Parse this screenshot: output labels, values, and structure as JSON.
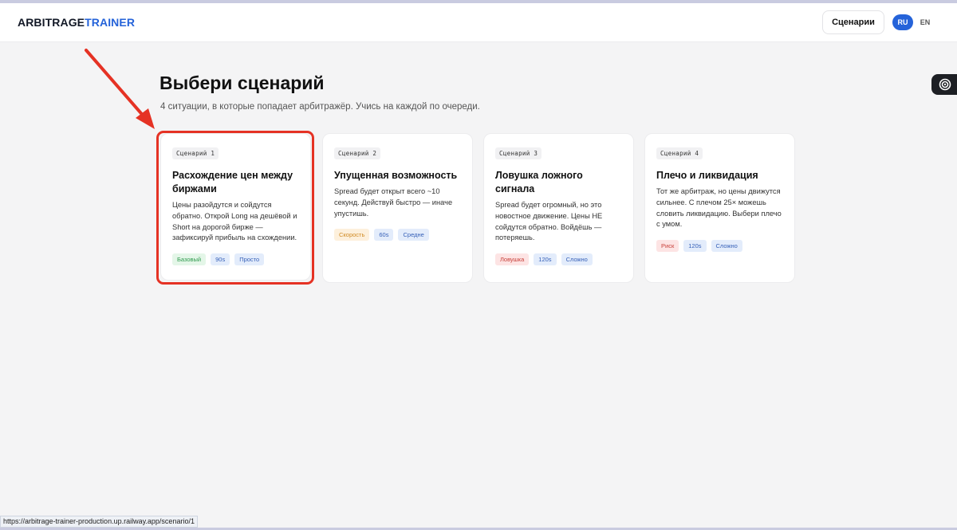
{
  "header": {
    "logo_part1": "ARBITRAGE",
    "logo_part2": "TRAINER",
    "nav_button": "Сценарии",
    "lang_ru": "RU",
    "lang_en": "EN"
  },
  "page": {
    "title": "Выбери сценарий",
    "subtitle": "4 ситуации, в которые попадает арбитражёр. Учись на каждой по очереди."
  },
  "cards": [
    {
      "tag": "Сценарий 1",
      "title": "Расхождение цен между биржами",
      "description": "Цены разойдутся и сойдутся обратно. Открой Long на дешёвой и Short на дорогой бирже — зафиксируй прибыль на схождении.",
      "badges": [
        "Базовый",
        "90s",
        "Просто"
      ]
    },
    {
      "tag": "Сценарий 2",
      "title": "Упущенная возможность",
      "description": "Spread будет открыт всего ~10 секунд. Действуй быстро — иначе упустишь.",
      "badges": [
        "Скорость",
        "60s",
        "Средне"
      ]
    },
    {
      "tag": "Сценарий 3",
      "title": "Ловушка ложного сигнала",
      "description": "Spread будет огромный, но это новостное движение. Цены НЕ сойдутся обратно. Войдёшь — потеряешь.",
      "badges": [
        "Ловушка",
        "120s",
        "Сложно"
      ]
    },
    {
      "tag": "Сценарий 4",
      "title": "Плечо и ликвидация",
      "description": "Тот же арбитраж, но цены движутся сильнее. С плечом 25× можешь словить ликвидацию. Выбери плечо с умом.",
      "badges": [
        "Риск",
        "120s",
        "Сложно"
      ]
    }
  ],
  "status_bar": {
    "url": "https://arbitrage-trainer-production.up.railway.app/scenario/1"
  },
  "colors": {
    "accent": "#2563d9",
    "highlight": "#e53224"
  },
  "icons": {
    "side_widget": "target-icon",
    "annotation": "red-arrow-icon"
  }
}
